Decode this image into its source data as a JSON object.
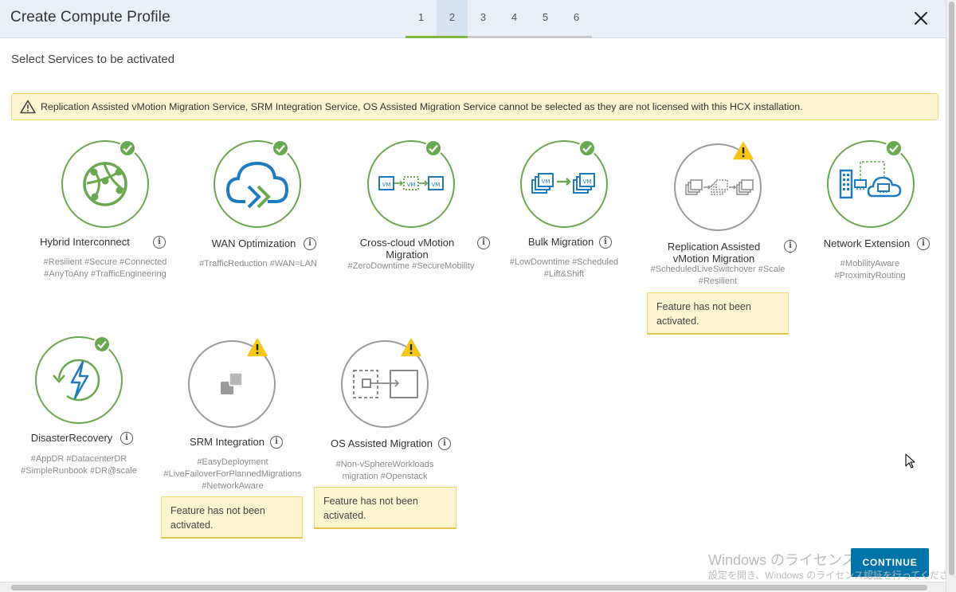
{
  "header": {
    "title": "Create Compute Profile",
    "steps": [
      "1",
      "2",
      "3",
      "4",
      "5",
      "6"
    ],
    "active_step": "2"
  },
  "subtitle": "Select Services to be activated",
  "alert": {
    "text": "Replication Assisted vMotion Migration Service, SRM Integration Service, OS Assisted Migration Service cannot be selected as they are not licensed with this HCX installation."
  },
  "services": [
    {
      "name": "Hybrid Interconnect",
      "tags": [
        "#Resilient #Secure #Connected",
        "#AnyToAny #TrafficEngineering"
      ],
      "status": "activated"
    },
    {
      "name": "WAN Optimization",
      "tags": [
        "#TrafficReduction #WAN=LAN"
      ],
      "status": "activated"
    },
    {
      "name": [
        "Cross-cloud vMotion",
        "Migration"
      ],
      "tags": [
        "#ZeroDowntime #SecureMobility"
      ],
      "status": "activated"
    },
    {
      "name": "Bulk Migration",
      "tags": [
        "#LowDowntime #Scheduled",
        "#Lift&Shift"
      ],
      "status": "activated"
    },
    {
      "name": [
        "Replication Assisted",
        "vMotion Migration"
      ],
      "tags": [
        "#ScheduledLiveSwitchover #Scale",
        "#Resilient"
      ],
      "status": "not-licensed",
      "note": "Feature has not been activated."
    },
    {
      "name": "Network Extension",
      "tags": [
        "#MobilityAware",
        "#ProximityRouting"
      ],
      "status": "activated"
    },
    {
      "name": "DisasterRecovery",
      "tags": [
        "#AppDR #DatacenterDR",
        "#SimpleRunbook #DR@scale"
      ],
      "status": "activated"
    },
    {
      "name": "SRM Integration",
      "tags": [
        "#EasyDeployment",
        "#LiveFailoverForPlannedMigrations",
        "#NetworkAware"
      ],
      "status": "not-licensed",
      "note": "Feature has not been activated."
    },
    {
      "name": "OS Assisted Migration",
      "tags": [
        "#Non-vSphereWorkloads",
        "migration #Openstack"
      ],
      "status": "not-licensed",
      "note": "Feature has not been activated."
    }
  ],
  "watermark": {
    "line1": "Windows のライセンス認証",
    "line2": "設定を開き、Windows のライセンス認証を行ってください。"
  },
  "footer": {
    "continue_label": "CONTINUE"
  },
  "colors": {
    "active": "#6aa84f",
    "inactive": "#9b9b9b",
    "icon_blue": "#1e7bbf",
    "warning": "#f5c518",
    "primary": "#0073a8"
  },
  "icons": {
    "hybrid-interconnect": "globe-network-icon",
    "wan-optimization": "cloud-forward-icon",
    "cross-cloud-vmotion": "vm-to-vm-icon",
    "bulk-migration": "vm-stack-migration-icon",
    "replication-assisted": "vm-replication-icon",
    "network-extension": "building-cloud-icon",
    "disaster-recovery": "recovery-bolt-icon",
    "srm-integration": "srm-blocks-icon",
    "os-assisted": "os-migration-icon"
  }
}
